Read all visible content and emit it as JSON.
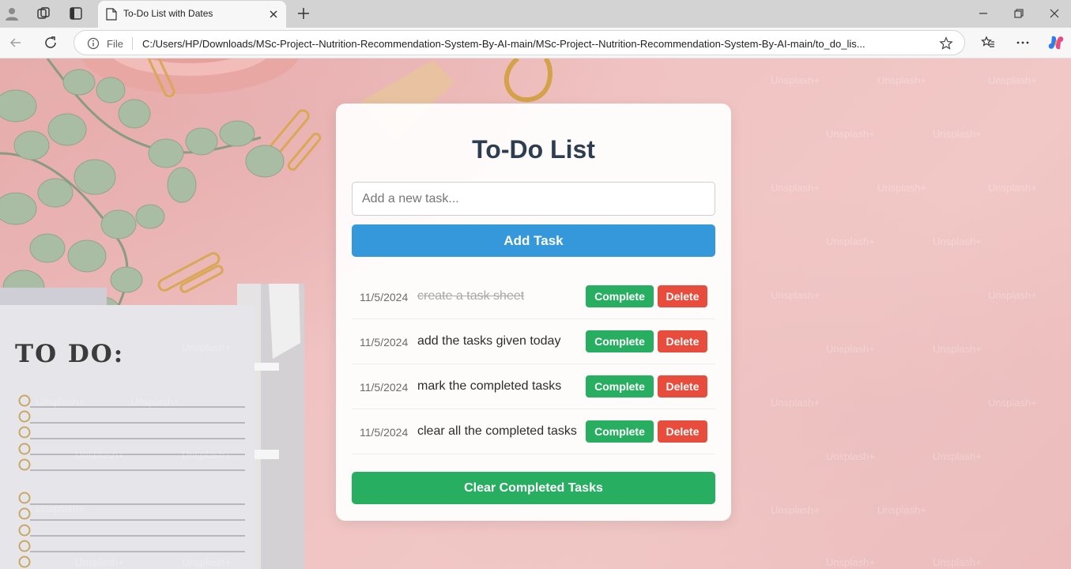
{
  "browser": {
    "tab_title": "To-Do List with Dates",
    "omnibox": {
      "scheme_label": "File",
      "url": "C:/Users/HP/Downloads/MSc-Project--Nutrition-Recommendation-System-By-AI-main/MSc-Project--Nutrition-Recommendation-System-By-AI-main/to_do_lis..."
    }
  },
  "background": {
    "notepad_title": "TO DO:",
    "watermark": "Unsplash+"
  },
  "todo": {
    "title": "To-Do List",
    "input_placeholder": "Add a new task...",
    "add_button": "Add Task",
    "tasks": [
      {
        "date": "11/5/2024",
        "text": "create a task sheet",
        "completed": true,
        "complete_label": "Complete",
        "delete_label": "Delete"
      },
      {
        "date": "11/5/2024",
        "text": "add the tasks given today",
        "completed": false,
        "complete_label": "Complete",
        "delete_label": "Delete"
      },
      {
        "date": "11/5/2024",
        "text": "mark the completed tasks",
        "completed": false,
        "complete_label": "Complete",
        "delete_label": "Delete"
      },
      {
        "date": "11/5/2024",
        "text": "clear all the completed tasks",
        "completed": false,
        "complete_label": "Complete",
        "delete_label": "Delete"
      }
    ],
    "clear_button": "Clear Completed Tasks"
  },
  "colors": {
    "title": "#2c3e50",
    "add_button": "#3498db",
    "complete_button": "#27ae60",
    "delete_button": "#e74c3c",
    "clear_button": "#27ae60"
  }
}
